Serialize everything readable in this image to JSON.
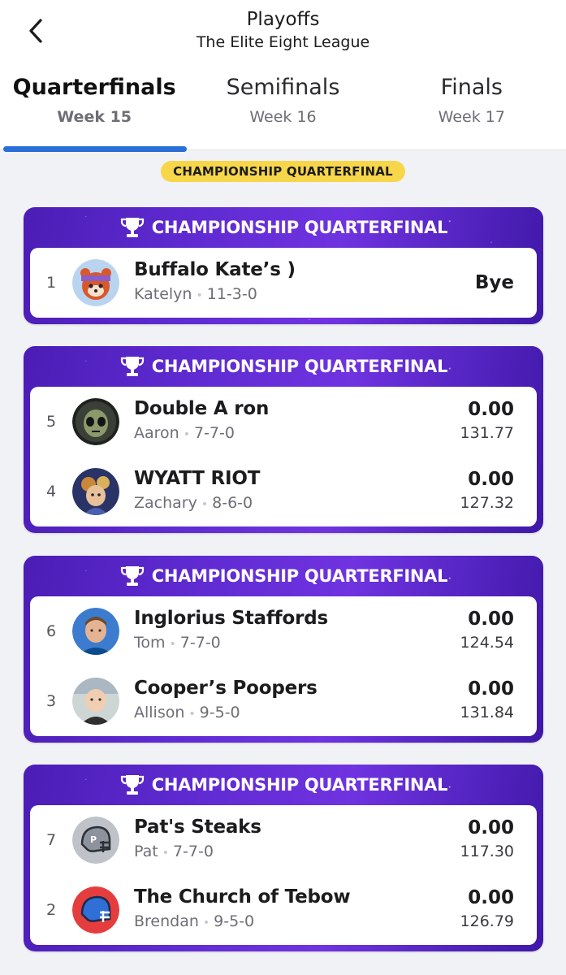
{
  "header": {
    "title": "Playoffs",
    "subtitle": "The Elite Eight League"
  },
  "tabs": [
    {
      "name": "Quarterfinals",
      "week": "Week 15",
      "active": true
    },
    {
      "name": "Semifinals",
      "week": "Week 16",
      "active": false
    },
    {
      "name": "Finals",
      "week": "Week 17",
      "active": false
    }
  ],
  "round_pill": "CHAMPIONSHIP QUARTERFINAL",
  "matchups": [
    {
      "label": "CHAMPIONSHIP QUARTERFINAL",
      "teams": [
        {
          "seed": "1",
          "name": "Buffalo Kate’s )",
          "owner": "Katelyn",
          "record": "11-3-0",
          "result": "Bye",
          "avatar": "red-panda-avatar"
        }
      ]
    },
    {
      "label": "CHAMPIONSHIP QUARTERFINAL",
      "teams": [
        {
          "seed": "5",
          "name": "Double A ron",
          "owner": "Aaron",
          "record": "7-7-0",
          "score": "0.00",
          "projected": "131.77",
          "avatar": "alien-avatar"
        },
        {
          "seed": "4",
          "name": "WYATT RIOT",
          "owner": "Zachary",
          "record": "8-6-0",
          "score": "0.00",
          "projected": "127.32",
          "avatar": "character-avatar"
        }
      ]
    },
    {
      "label": "CHAMPIONSHIP QUARTERFINAL",
      "teams": [
        {
          "seed": "6",
          "name": "Inglorius Staffords",
          "owner": "Tom",
          "record": "7-7-0",
          "score": "0.00",
          "projected": "124.54",
          "avatar": "player-photo-avatar"
        },
        {
          "seed": "3",
          "name": "Cooper’s Poopers",
          "owner": "Allison",
          "record": "9-5-0",
          "score": "0.00",
          "projected": "131.84",
          "avatar": "baby-photo-avatar"
        }
      ]
    },
    {
      "label": "CHAMPIONSHIP QUARTERFINAL",
      "teams": [
        {
          "seed": "7",
          "name": "Pat's Steaks",
          "owner": "Pat",
          "record": "7-7-0",
          "score": "0.00",
          "projected": "117.30",
          "avatar": "gray-helmet-avatar"
        },
        {
          "seed": "2",
          "name": "The Church of Tebow",
          "owner": "Brendan",
          "record": "9-5-0",
          "score": "0.00",
          "projected": "126.79",
          "avatar": "blue-helmet-avatar"
        }
      ]
    }
  ],
  "colors": {
    "accent_blue": "#2a6ed9",
    "pill_yellow": "#f7d64a",
    "card_purple": "#5e2ad0",
    "background": "#f1f2f6"
  }
}
